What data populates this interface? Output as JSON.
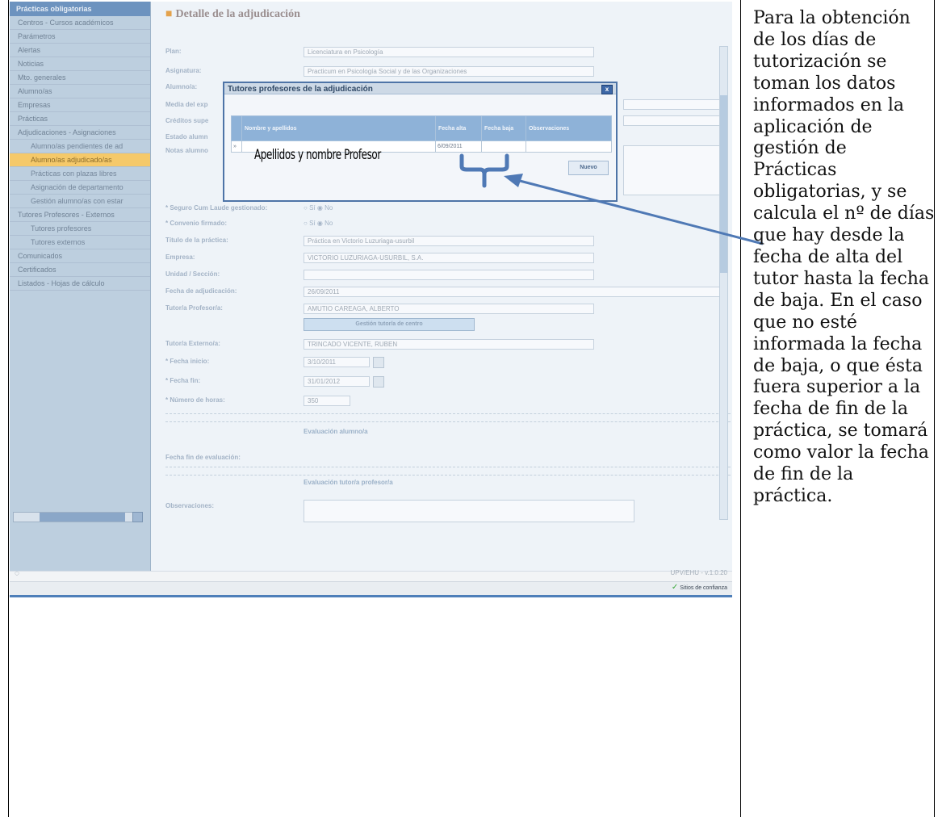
{
  "note_text": "Para la obtención de los días de tutorización se toman los datos informados en la aplicación de gestión de Prácticas obligatorias, y se calcula el nº de días que hay desde la fecha de alta del tutor hasta la fecha de baja.  En el caso que no esté informada la fecha de baja, o que ésta fuera superior a la fecha de fin de la práctica, se tomará como valor la fecha de fin de la práctica.",
  "annotation": {
    "handwritten_label": "Apellidos y nombre Profesor",
    "arrow_color": "#4f79b5"
  },
  "sidebar": {
    "header": "Prácticas obligatorias",
    "items": [
      {
        "label": "Centros - Cursos académicos"
      },
      {
        "label": "Parámetros"
      },
      {
        "label": "Alertas"
      },
      {
        "label": "Noticias"
      },
      {
        "label": "Mto. generales"
      },
      {
        "label": "Alumno/as"
      },
      {
        "label": "Empresas"
      },
      {
        "label": "Prácticas"
      },
      {
        "label": "Adjudicaciones - Asignaciones"
      },
      {
        "label": "Alumno/as pendientes de ad"
      },
      {
        "label": "Alumno/as adjudicado/as"
      },
      {
        "label": "Prácticas con plazas libres"
      },
      {
        "label": "Asignación de departamento"
      },
      {
        "label": "Gestión alumno/as con estar"
      },
      {
        "label": "Tutores Profesores - Externos"
      },
      {
        "label": "Tutores profesores"
      },
      {
        "label": "Tutores externos"
      },
      {
        "label": "Comunicados"
      },
      {
        "label": "Certificados"
      },
      {
        "label": "Listados - Hojas de cálculo"
      }
    ]
  },
  "main": {
    "title": "Detalle de la adjudicación",
    "plan_label": "Plan:",
    "plan_value": "Licenciatura en Psicología",
    "asignatura_label": "Asignatura:",
    "asignatura_value": "Practicum en Psicología Social y de las Organizaciones",
    "alumno_label": "Alumno/a:",
    "media_label": "Media del exp",
    "creditos_label": "Créditos supe",
    "estado_label": "Estado alumn",
    "notas_label": "Notas alumno",
    "seguro_label": "* Seguro Cum Laude gestionado:",
    "convenio_label": "* Convenio firmado:",
    "radio_si": "Sí",
    "radio_no": "No",
    "titulo_label": "Título de la práctica:",
    "titulo_value": "Práctica en Victorio Luzuriaga-usurbil",
    "empresa_label": "Empresa:",
    "empresa_value": "VICTORIO LUZURIAGA-USURBIL, S.A.",
    "unidad_label": "Unidad / Sección:",
    "fecha_adj_label": "Fecha de adjudicación:",
    "fecha_adj_value": "26/09/2011",
    "tutor_prof_label": "Tutor/a Profesor/a:",
    "tutor_prof_value": "AMUTIO CAREAGA, ALBERTO",
    "gestion_button": "Gestión tutor/a de centro",
    "tutor_ext_label": "Tutor/a Externo/a:",
    "tutor_ext_value": "TRINCADO VICENTE, RUBEN",
    "fecha_inicio_label": "* Fecha inicio:",
    "fecha_inicio_value": "3/10/2011",
    "fecha_fin_label": "* Fecha fin:",
    "fecha_fin_value": "31/01/2012",
    "horas_label": "* Número de horas:",
    "horas_value": "350",
    "eval_alumno": "Evaluación alumno/a",
    "fecha_fin_eval_label": "Fecha fin de evaluación:",
    "eval_tutor": "Evaluación tutor/a profesor/a",
    "observaciones_label": "Observaciones:",
    "version": "UPV/EHU - v.1.0.20",
    "trusted_sites": "Sitios de confianza"
  },
  "popup": {
    "title": "Tutores profesores de la adjudicación",
    "close": "x",
    "columns": [
      "Nombre y apellidos",
      "Fecha alta",
      "Fecha baja",
      "Observaciones"
    ],
    "row": {
      "marker": "»",
      "fecha_alta": "6/09/2011"
    },
    "new_button": "Nuevo"
  }
}
